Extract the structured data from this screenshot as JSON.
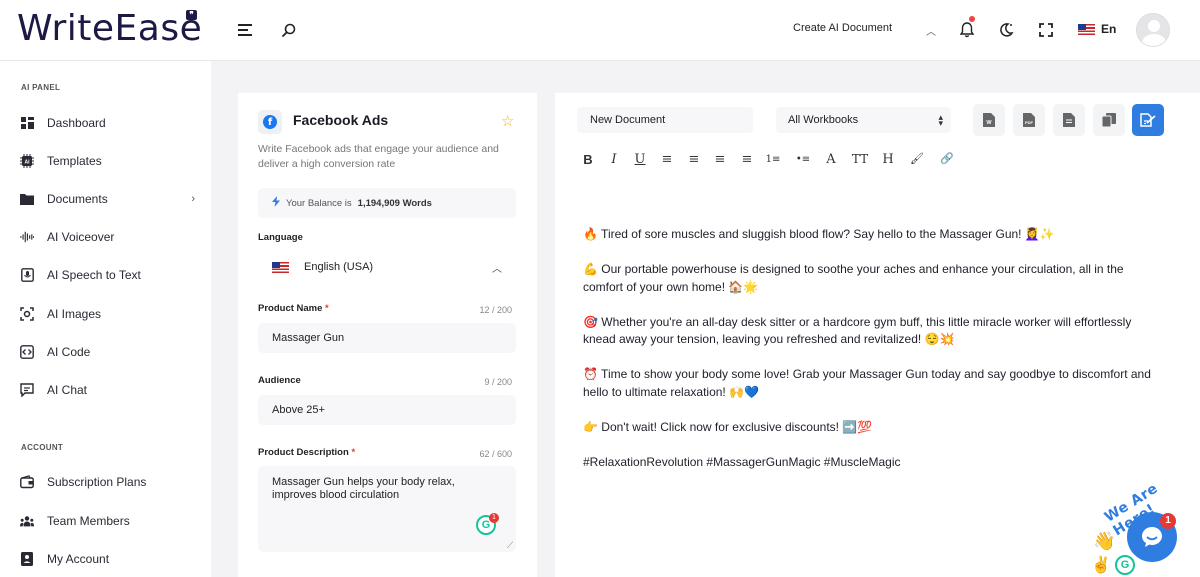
{
  "header": {
    "logo": "WriteEase",
    "create_doc": "Create AI Document",
    "language": "En"
  },
  "sidebar": {
    "sections": [
      {
        "title": "AI PANEL"
      },
      {
        "title": "ACCOUNT"
      }
    ],
    "items": [
      {
        "label": "Dashboard"
      },
      {
        "label": "Templates"
      },
      {
        "label": "Documents"
      },
      {
        "label": "AI Voiceover"
      },
      {
        "label": "AI Speech to Text"
      },
      {
        "label": "AI Images"
      },
      {
        "label": "AI Code"
      },
      {
        "label": "AI Chat"
      },
      {
        "label": "Subscription Plans"
      },
      {
        "label": "Team Members"
      },
      {
        "label": "My Account"
      }
    ]
  },
  "form": {
    "title": "Facebook Ads",
    "description": "Write Facebook ads that engage your audience and deliver a high conversion rate",
    "balance_prefix": "Your Balance is",
    "balance_value": "1,194,909 Words",
    "language_label": "Language",
    "language_value": "English (USA)",
    "product_name_label": "Product Name",
    "product_name_count": "12 / 200",
    "product_name_value": "Massager Gun",
    "audience_label": "Audience",
    "audience_count": "9 / 200",
    "audience_value": "Above 25+",
    "description_label": "Product Description",
    "description_count": "62 / 600",
    "description_value": "Massager Gun helps your body relax, improves blood circulation",
    "grammarly_count": "1",
    "required_mark": "*"
  },
  "editor": {
    "doc_name": "New Document",
    "workbook": "All Workbooks",
    "toolbar": [
      "B",
      "I",
      "U",
      "≡",
      "≡",
      "≡",
      "≡",
      "1≡",
      "•≡",
      "A",
      "TT",
      "H",
      "🖌",
      "🔗"
    ],
    "paragraphs": [
      "🔥 Tired of sore muscles and sluggish blood flow? Say hello to the Massager Gun! 💆‍♀️✨",
      "💪 Our portable powerhouse is designed to soothe your aches and enhance your circulation, all in the comfort of your own home! 🏠🌟",
      "🎯 Whether you're an all-day desk sitter or a hardcore gym buff, this little miracle worker will effortlessly knead away your tension, leaving you refreshed and revitalized! 😌💥",
      "⏰ Time to show your body some love! Grab your Massager Gun today and say goodbye to discomfort and hello to ultimate relaxation! 🙌💙",
      "👉 Don't wait! Click now for exclusive discounts! ➡️💯",
      "#RelaxationRevolution #MassagerGunMagic #MuscleMagic"
    ]
  },
  "chat": {
    "label": "We Are Here!",
    "count": "1"
  },
  "colors": {
    "accent": "#2f7de1",
    "brand": "#1c1a45",
    "facebook": "#1877f2",
    "required": "#e53935"
  }
}
